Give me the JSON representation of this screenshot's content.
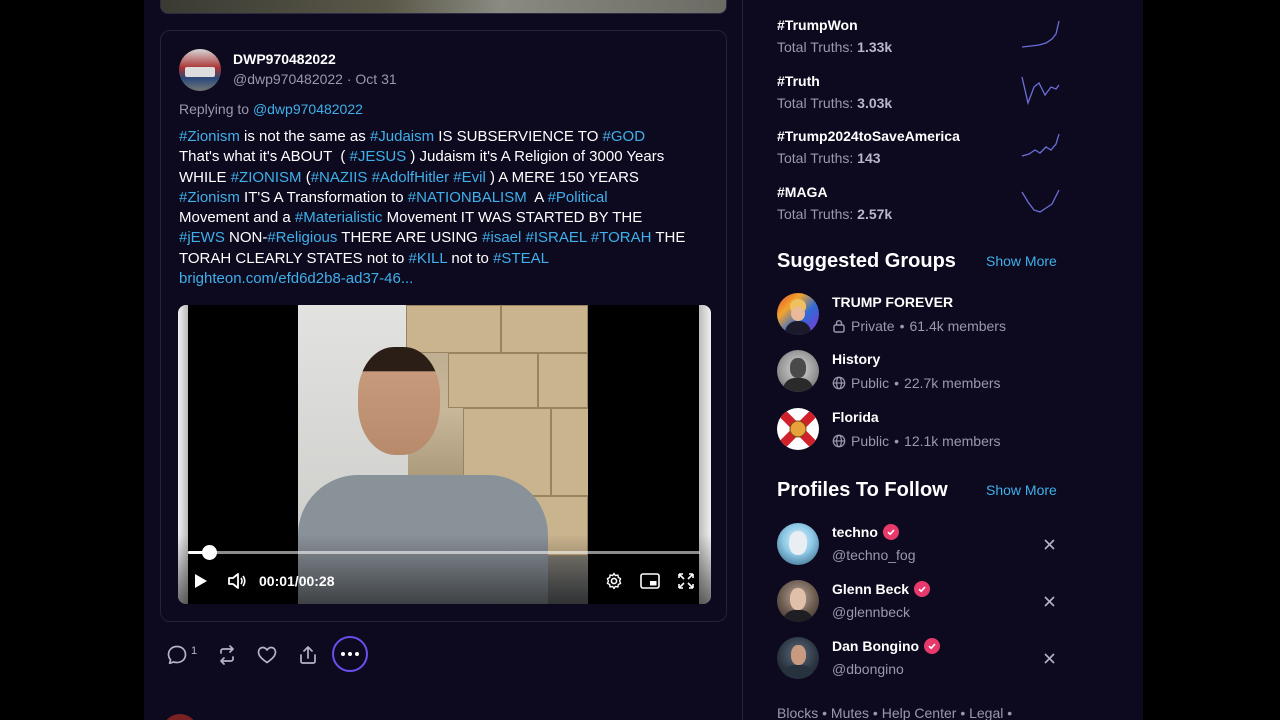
{
  "post": {
    "quote": {
      "display_name": "DWP970482022",
      "handle_meta": "@dwp970482022 · Oct 31",
      "replying_prefix": "Replying to ",
      "replying_mention": "@dwp970482022",
      "body": [
        [
          [
            "t",
            "#Zionism"
          ],
          [
            "p",
            " is not the same as "
          ],
          [
            "t",
            "#Judaism"
          ],
          [
            "p",
            " IS SUBSERVIENCE TO "
          ],
          [
            "t",
            "#GOD"
          ]
        ],
        [
          [
            "p",
            "That's what it's ABOUT  ( "
          ],
          [
            "t",
            "#JESUS"
          ],
          [
            "p",
            " ) Judaism it's A Religion of 3000 Years"
          ]
        ],
        [
          [
            "p",
            "WHILE "
          ],
          [
            "t",
            "#ZIONISM"
          ],
          [
            "p",
            " ("
          ],
          [
            "t",
            "#NAZIIS"
          ],
          [
            "p",
            " "
          ],
          [
            "t",
            "#AdolfHitler"
          ],
          [
            "p",
            " "
          ],
          [
            "t",
            "#Evil"
          ],
          [
            "p",
            " ) A MERE 150 YEARS"
          ]
        ],
        [
          [
            "t",
            "#Zionism"
          ],
          [
            "p",
            " IT'S A Transformation to "
          ],
          [
            "t",
            "#NATIONBALISM"
          ],
          [
            "p",
            "  A "
          ],
          [
            "t",
            "#Political"
          ]
        ],
        [
          [
            "p",
            "Movement and a "
          ],
          [
            "t",
            "#Materialistic"
          ],
          [
            "p",
            " Movement IT WAS STARTED BY THE"
          ]
        ],
        [
          [
            "t",
            "#jEWS"
          ],
          [
            "p",
            " NON-"
          ],
          [
            "t",
            "#Religious"
          ],
          [
            "p",
            " THERE ARE USING "
          ],
          [
            "t",
            "#isael"
          ],
          [
            "p",
            " "
          ],
          [
            "t",
            "#ISRAEL"
          ],
          [
            "p",
            " "
          ],
          [
            "t",
            "#TORAH"
          ],
          [
            "p",
            " THE"
          ]
        ],
        [
          [
            "p",
            "TORAH CLEARLY STATES not to "
          ],
          [
            "t",
            "#KILL"
          ],
          [
            "p",
            " not to "
          ],
          [
            "t",
            "#STEAL"
          ]
        ],
        [
          [
            "t",
            "brighteon.com/efd6d2b8-ad37-46..."
          ]
        ]
      ],
      "video": {
        "time": "00:01/00:28",
        "progress": 0.036
      }
    },
    "actions": {
      "reply_count": "1"
    }
  },
  "sidebar": {
    "trends": [
      {
        "tag": "#TrumpWon",
        "label": "Total Truths: ",
        "count": "1.33k",
        "spark": "up"
      },
      {
        "tag": "#Truth",
        "label": "Total Truths: ",
        "count": "3.03k",
        "spark": "zigzag"
      },
      {
        "tag": "#Trump2024toSaveAmerica",
        "label": "Total Truths: ",
        "count": "143",
        "spark": "up-wave"
      },
      {
        "tag": "#MAGA",
        "label": "Total Truths: ",
        "count": "2.57k",
        "spark": "dip"
      }
    ],
    "groups_title": "Suggested Groups",
    "groups_show_more": "Show More",
    "groups": [
      {
        "name": "TRUMP FOREVER",
        "privacy": "Private",
        "members": "61.4k members",
        "icon": "lock-icon"
      },
      {
        "name": "History",
        "privacy": "Public",
        "members": "22.7k members",
        "icon": "globe-icon"
      },
      {
        "name": "Florida",
        "privacy": "Public",
        "members": "12.1k members",
        "icon": "globe-icon"
      }
    ],
    "profiles_title": "Profiles To Follow",
    "profiles_show_more": "Show More",
    "profiles": [
      {
        "name": "techno",
        "handle": "@techno_fog"
      },
      {
        "name": "Glenn Beck",
        "handle": "@glennbeck"
      },
      {
        "name": "Dan Bongino",
        "handle": "@dbongino"
      }
    ],
    "footer": "Blocks • Mutes • Help Center • Legal •"
  },
  "colors": {
    "background": "#0d0a1f",
    "link": "#3fb0ea",
    "muted": "#9a98ad",
    "verified": "#e7396b",
    "accent": "#6b4ef2"
  }
}
